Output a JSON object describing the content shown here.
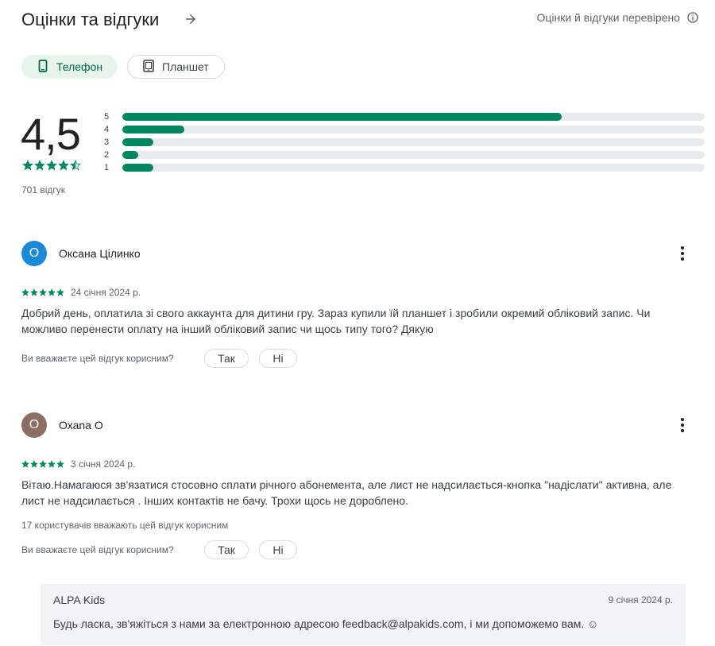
{
  "header": {
    "title": "Оцінки та відгуки",
    "verified_text": "Оцінки й відгуки перевірено"
  },
  "device_chips": [
    {
      "label": "Телефон",
      "selected": true,
      "icon": "phone-icon"
    },
    {
      "label": "Планшет",
      "selected": false,
      "icon": "tablet-icon"
    }
  ],
  "summary": {
    "rating": "4,5",
    "stars": 4.5,
    "total_reviews": "701 відгук",
    "histogram": [
      {
        "label": "5",
        "fraction": 0.755
      },
      {
        "label": "4",
        "fraction": 0.107
      },
      {
        "label": "3",
        "fraction": 0.053
      },
      {
        "label": "2",
        "fraction": 0.027
      },
      {
        "label": "1",
        "fraction": 0.053
      }
    ]
  },
  "colors": {
    "accent_green": "#01875f",
    "chip_selected_bg": "#e6f4ea",
    "track": "#e8eaed"
  },
  "reviews": [
    {
      "author": "Оксана Цілинко",
      "avatar_letter": "О",
      "avatar_color": "#1a8ad6",
      "stars": 5,
      "date": "24 січня 2024 р.",
      "text": "Добрий день, оплатила зі свого аккаунта для дитини гру. Зараз купили їй планшет і зробили окремий обліковий запис. Чи можливо перенести оплату на інший обліковий запис чи щось типу того? Дякую",
      "helpful_count": "",
      "helpful_question": "Ви вважаєте цей відгук корисним?",
      "yes_label": "Так",
      "no_label": "Ні"
    },
    {
      "author": "Охаnа О",
      "avatar_letter": "О",
      "avatar_color": "#8d6e63",
      "stars": 5,
      "date": "3 січня 2024 р.",
      "text": "Вітаю.Намагаюся зв'язатися стосовно сплати річного абонемента, але лист не надсилається-кнопка \"надіслати\" активна, але лист не надсилається . Інших контактів не бачу. Трохи щось не дороблено.",
      "helpful_count": "17 користувачів вважають цей відгук корисним",
      "helpful_question": "Ви вважаєте цей відгук корисним?",
      "yes_label": "Так",
      "no_label": "Ні"
    }
  ],
  "developer_reply": {
    "name": "ALPA Kids",
    "date": "9 січня 2024 р.",
    "text": "Будь ласка, зв'яжіться з нами за електронною адресою feedback@alpakids.com, і ми допоможемо вам. ☺"
  }
}
